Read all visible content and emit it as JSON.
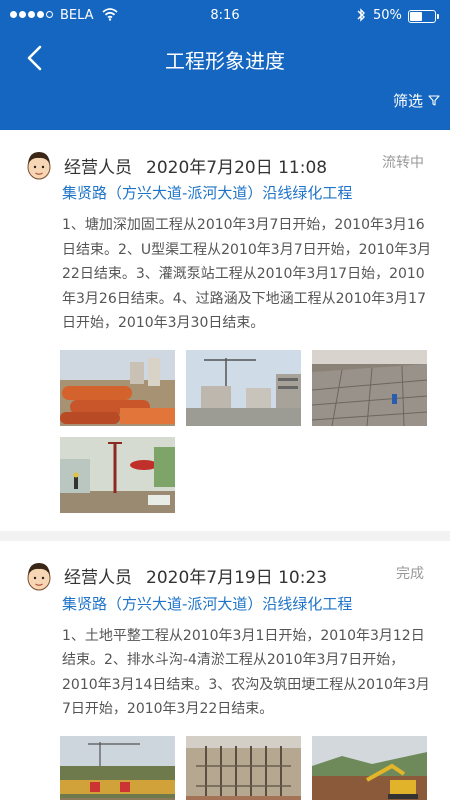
{
  "status_bar": {
    "carrier": "BELA",
    "time": "8:16",
    "battery": "50%",
    "battery_level": 0.5
  },
  "nav": {
    "title": "工程形象进度",
    "filter_label": "筛选"
  },
  "feed": [
    {
      "author": "经营人员",
      "datetime": "2020年7月20日  11:08",
      "status": "流转中",
      "project": "集贤路（方兴大道-派河大道）沿线绿化工程",
      "description": "1、塘加深加固工程从2010年3月7日开始，2010年3月16日结束。2、U型渠工程从2010年3月7日开始，2010年3月22日结束。3、灌溉泵站工程从2010年3月17日始，2010年3月26日结束。4、过路涵及下地涵工程从2010年3月17日开始，2010年3月30日结束。"
    },
    {
      "author": "经营人员",
      "datetime": "2020年7月19日  10:23",
      "status": "完成",
      "project": "集贤路（方兴大道-派河大道）沿线绿化工程",
      "description": "1、土地平整工程从2010年3月1日开始，2010年3月12日结束。2、排水斗沟-4清淤工程从2010年3月7日开始，2010年3月14日结束。3、农沟及筑田埂工程从2010年3月7日开始，2010年3月22日结束。"
    }
  ],
  "colors": {
    "header": "#1466c0",
    "link": "#1e74c8",
    "muted": "#9a9a9a"
  }
}
